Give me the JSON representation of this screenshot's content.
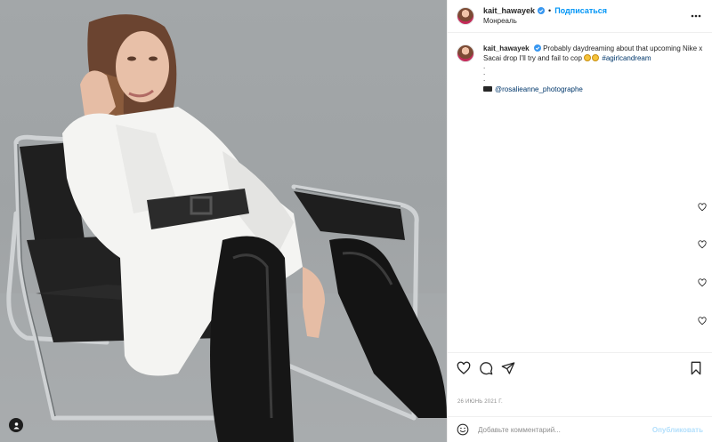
{
  "header": {
    "username": "kait_hawayek",
    "separator": "•",
    "follow_label": "Подписаться",
    "location": "Монреаль"
  },
  "caption": {
    "username": "kait_hawayek",
    "text": "Probably daydreaming about that upcoming Nike x Sacai drop I'll try and fail to cop",
    "hashtag": "#agirlcandream",
    "dots": [
      ".",
      ".",
      "."
    ],
    "credit": "@rosalieanne_photographe"
  },
  "date": "26 ИЮНЬ 2021 Г.",
  "comment": {
    "placeholder": "Добавьте комментарий...",
    "publish_label": "Опубликовать"
  },
  "icons": {
    "verified": "verified-badge-icon",
    "more": "more-options-icon",
    "like": "heart-icon",
    "comment": "comment-icon",
    "share": "share-icon",
    "save": "bookmark-icon",
    "emoji": "emoji-icon",
    "tag": "user-tag-icon"
  },
  "colors": {
    "follow_blue": "#0095f6",
    "link_dark_blue": "#00376b",
    "muted_gray": "#8e8e8e",
    "publish_disabled": "#b2dffc"
  }
}
